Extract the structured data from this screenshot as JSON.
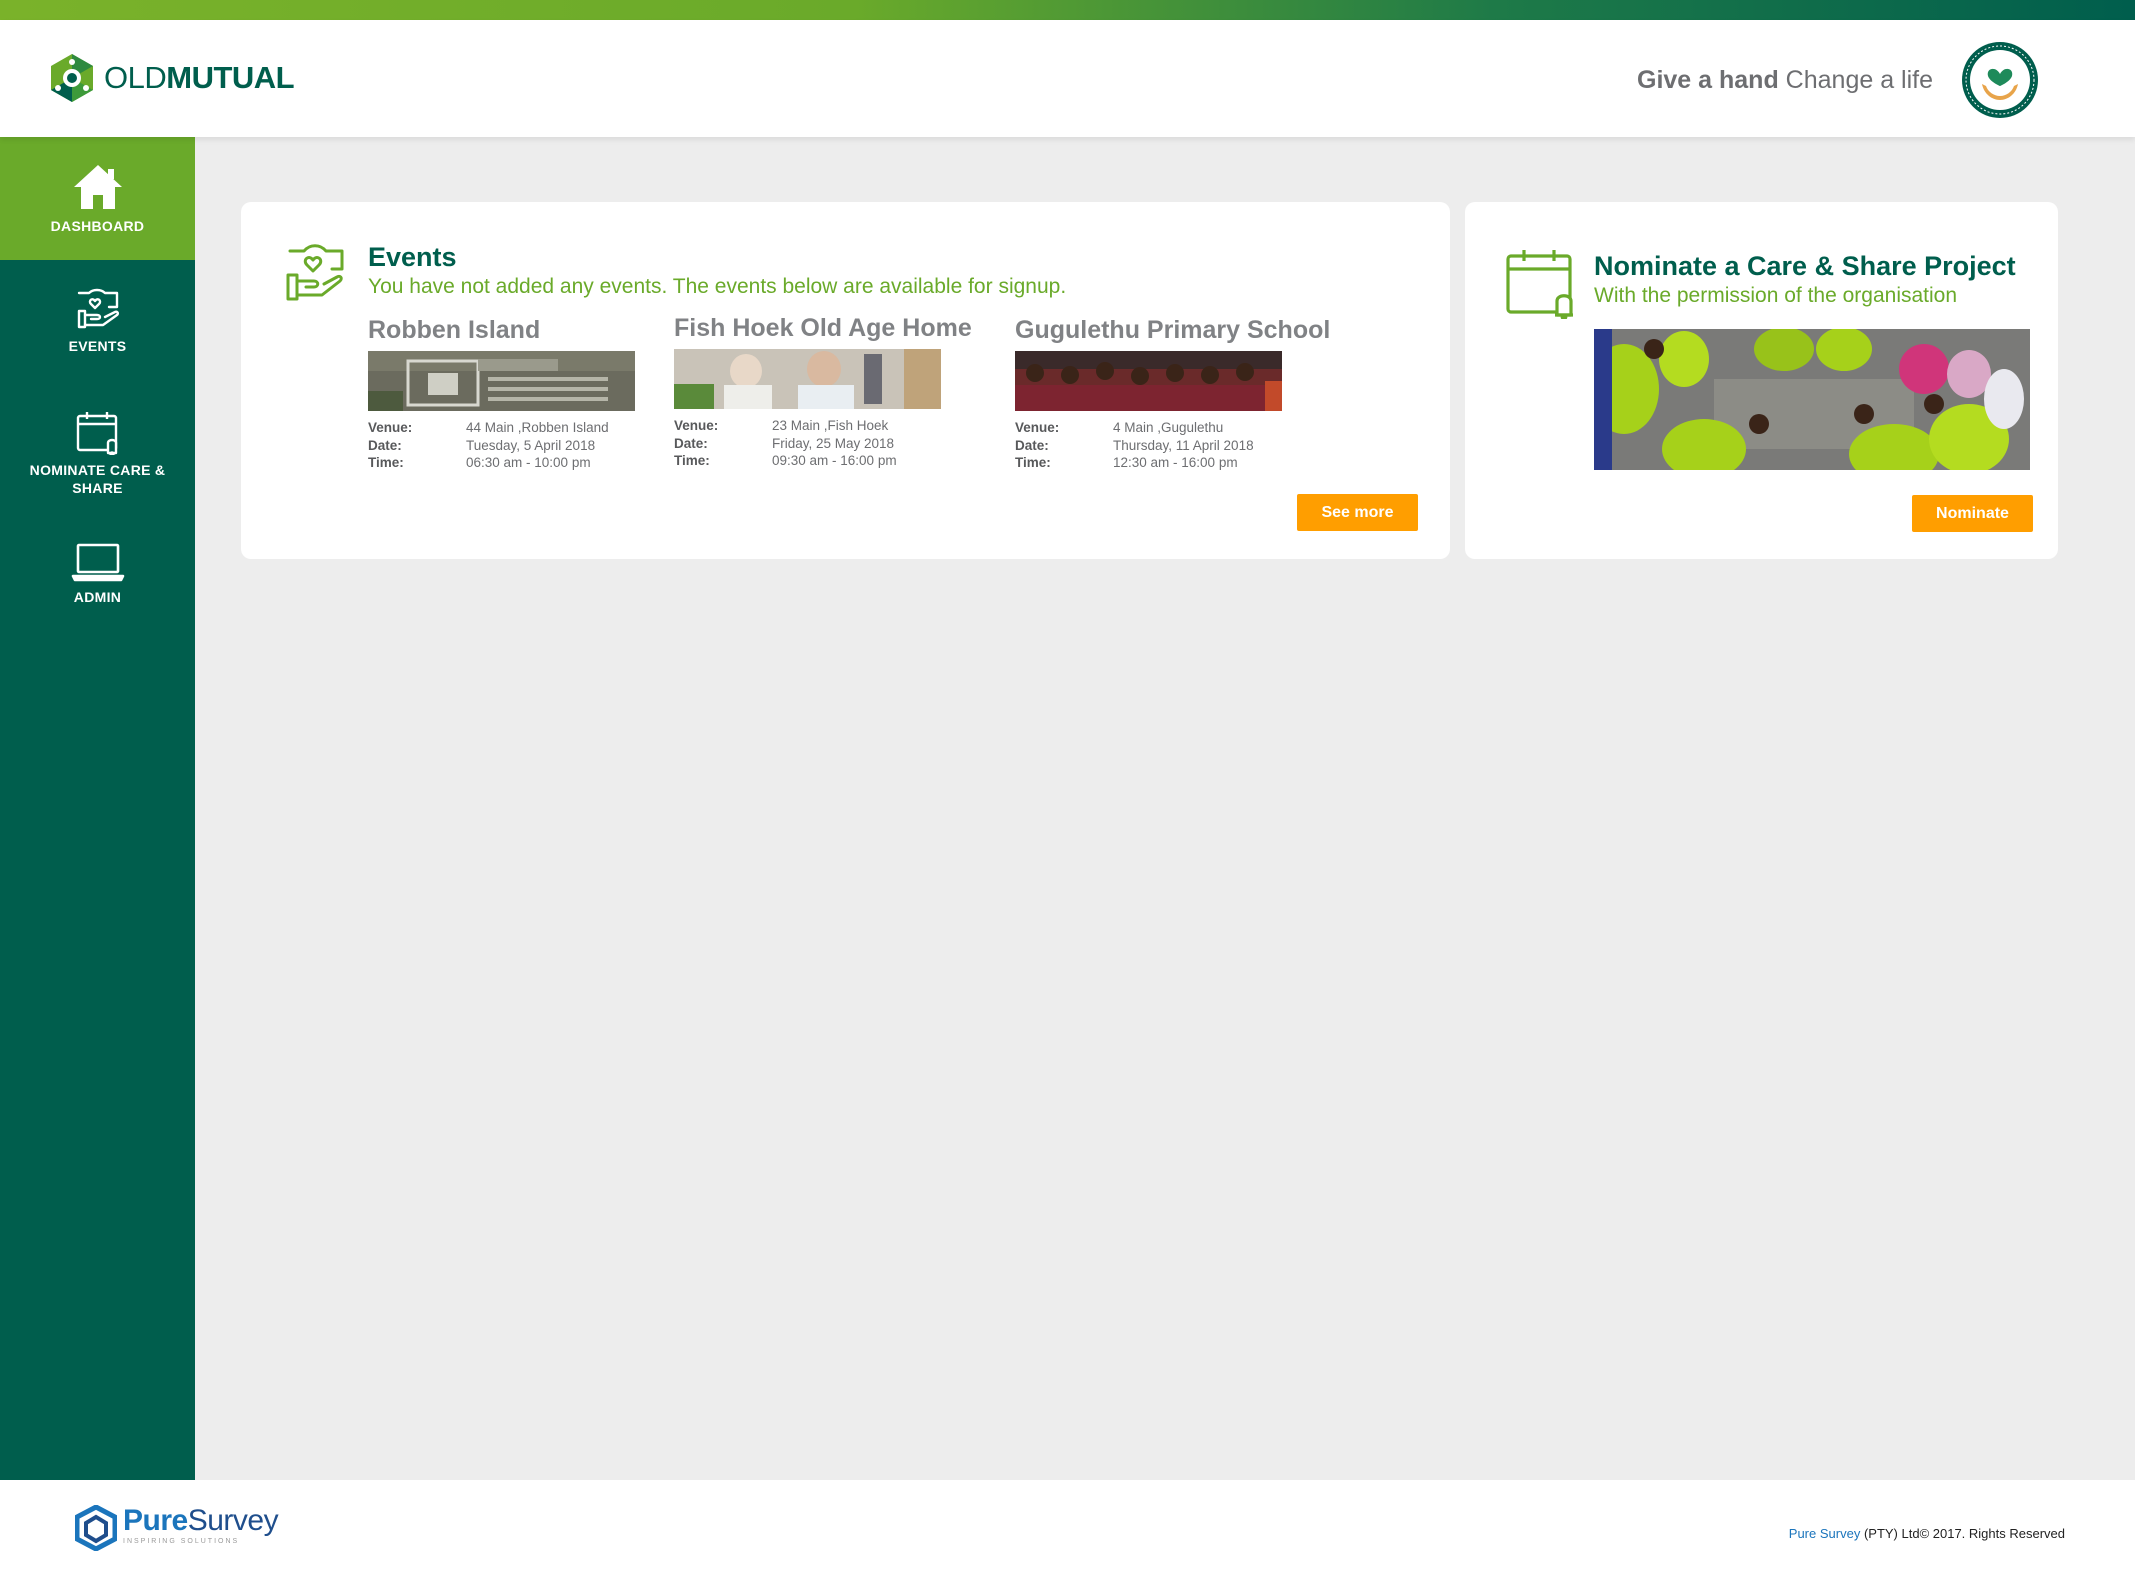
{
  "header": {
    "logo": {
      "old": "OLD",
      "mutual": "MUTUAL"
    },
    "tagline": {
      "bold": "Give a hand",
      "rest": "Change a life"
    }
  },
  "sidebar": {
    "items": [
      {
        "label": "DASHBOARD",
        "icon": "home-icon",
        "active": true
      },
      {
        "label": "EVENTS",
        "icon": "hand-heart-icon",
        "active": false
      },
      {
        "label_line1": "NOMINATE  CARE &",
        "label_line2": "SHARE",
        "icon": "calendar-bell-icon",
        "active": false
      },
      {
        "label": "ADMIN",
        "icon": "laptop-icon",
        "active": false
      }
    ]
  },
  "events": {
    "title": "Events",
    "subtitle": "You have not added any events. The events below are available for signup.",
    "list": [
      {
        "name": "Robben Island",
        "venue": "44 Main ,Robben Island",
        "date": "Tuesday, 5 April 2018",
        "time": "06:30 am - 10:00 pm"
      },
      {
        "name": "Fish Hoek Old Age Home",
        "venue": "23 Main ,Fish Hoek",
        "date": "Friday, 25 May 2018",
        "time": "09:30 am - 16:00 pm"
      },
      {
        "name": "Gugulethu Primary School",
        "venue": "4 Main ,Gugulethu",
        "date": "Thursday, 11 April 2018",
        "time": "12:30 am - 16:00 pm"
      }
    ],
    "labels": {
      "venue": "Venue:",
      "date": "Date:",
      "time": "Time:"
    },
    "see_more": "See more"
  },
  "nominate": {
    "title": "Nominate a Care & Share Project",
    "subtitle": "With the permission of the organisation",
    "button": "Nominate"
  },
  "footer": {
    "logo": {
      "pure": "Pure",
      "survey": "Survey",
      "tagline": "INSPIRING SOLUTIONS"
    },
    "copyright_brand": "Pure Survey",
    "copyright_rest": " (PTY) Ltd© 2017. Rights Reserved"
  },
  "colors": {
    "primary_green": "#005e4d",
    "accent_green": "#6aaa2a",
    "button_orange": "#ff9e00",
    "background": "#ededed"
  }
}
